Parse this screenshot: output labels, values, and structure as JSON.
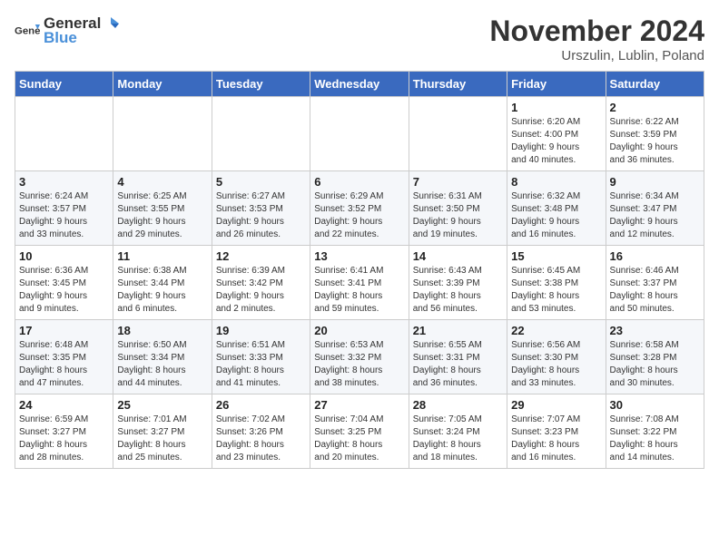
{
  "header": {
    "logo_general": "General",
    "logo_blue": "Blue",
    "month": "November 2024",
    "location": "Urszulin, Lublin, Poland"
  },
  "days_of_week": [
    "Sunday",
    "Monday",
    "Tuesday",
    "Wednesday",
    "Thursday",
    "Friday",
    "Saturday"
  ],
  "weeks": [
    [
      {
        "day": "",
        "info": ""
      },
      {
        "day": "",
        "info": ""
      },
      {
        "day": "",
        "info": ""
      },
      {
        "day": "",
        "info": ""
      },
      {
        "day": "",
        "info": ""
      },
      {
        "day": "1",
        "info": "Sunrise: 6:20 AM\nSunset: 4:00 PM\nDaylight: 9 hours\nand 40 minutes."
      },
      {
        "day": "2",
        "info": "Sunrise: 6:22 AM\nSunset: 3:59 PM\nDaylight: 9 hours\nand 36 minutes."
      }
    ],
    [
      {
        "day": "3",
        "info": "Sunrise: 6:24 AM\nSunset: 3:57 PM\nDaylight: 9 hours\nand 33 minutes."
      },
      {
        "day": "4",
        "info": "Sunrise: 6:25 AM\nSunset: 3:55 PM\nDaylight: 9 hours\nand 29 minutes."
      },
      {
        "day": "5",
        "info": "Sunrise: 6:27 AM\nSunset: 3:53 PM\nDaylight: 9 hours\nand 26 minutes."
      },
      {
        "day": "6",
        "info": "Sunrise: 6:29 AM\nSunset: 3:52 PM\nDaylight: 9 hours\nand 22 minutes."
      },
      {
        "day": "7",
        "info": "Sunrise: 6:31 AM\nSunset: 3:50 PM\nDaylight: 9 hours\nand 19 minutes."
      },
      {
        "day": "8",
        "info": "Sunrise: 6:32 AM\nSunset: 3:48 PM\nDaylight: 9 hours\nand 16 minutes."
      },
      {
        "day": "9",
        "info": "Sunrise: 6:34 AM\nSunset: 3:47 PM\nDaylight: 9 hours\nand 12 minutes."
      }
    ],
    [
      {
        "day": "10",
        "info": "Sunrise: 6:36 AM\nSunset: 3:45 PM\nDaylight: 9 hours\nand 9 minutes."
      },
      {
        "day": "11",
        "info": "Sunrise: 6:38 AM\nSunset: 3:44 PM\nDaylight: 9 hours\nand 6 minutes."
      },
      {
        "day": "12",
        "info": "Sunrise: 6:39 AM\nSunset: 3:42 PM\nDaylight: 9 hours\nand 2 minutes."
      },
      {
        "day": "13",
        "info": "Sunrise: 6:41 AM\nSunset: 3:41 PM\nDaylight: 8 hours\nand 59 minutes."
      },
      {
        "day": "14",
        "info": "Sunrise: 6:43 AM\nSunset: 3:39 PM\nDaylight: 8 hours\nand 56 minutes."
      },
      {
        "day": "15",
        "info": "Sunrise: 6:45 AM\nSunset: 3:38 PM\nDaylight: 8 hours\nand 53 minutes."
      },
      {
        "day": "16",
        "info": "Sunrise: 6:46 AM\nSunset: 3:37 PM\nDaylight: 8 hours\nand 50 minutes."
      }
    ],
    [
      {
        "day": "17",
        "info": "Sunrise: 6:48 AM\nSunset: 3:35 PM\nDaylight: 8 hours\nand 47 minutes."
      },
      {
        "day": "18",
        "info": "Sunrise: 6:50 AM\nSunset: 3:34 PM\nDaylight: 8 hours\nand 44 minutes."
      },
      {
        "day": "19",
        "info": "Sunrise: 6:51 AM\nSunset: 3:33 PM\nDaylight: 8 hours\nand 41 minutes."
      },
      {
        "day": "20",
        "info": "Sunrise: 6:53 AM\nSunset: 3:32 PM\nDaylight: 8 hours\nand 38 minutes."
      },
      {
        "day": "21",
        "info": "Sunrise: 6:55 AM\nSunset: 3:31 PM\nDaylight: 8 hours\nand 36 minutes."
      },
      {
        "day": "22",
        "info": "Sunrise: 6:56 AM\nSunset: 3:30 PM\nDaylight: 8 hours\nand 33 minutes."
      },
      {
        "day": "23",
        "info": "Sunrise: 6:58 AM\nSunset: 3:28 PM\nDaylight: 8 hours\nand 30 minutes."
      }
    ],
    [
      {
        "day": "24",
        "info": "Sunrise: 6:59 AM\nSunset: 3:27 PM\nDaylight: 8 hours\nand 28 minutes."
      },
      {
        "day": "25",
        "info": "Sunrise: 7:01 AM\nSunset: 3:27 PM\nDaylight: 8 hours\nand 25 minutes."
      },
      {
        "day": "26",
        "info": "Sunrise: 7:02 AM\nSunset: 3:26 PM\nDaylight: 8 hours\nand 23 minutes."
      },
      {
        "day": "27",
        "info": "Sunrise: 7:04 AM\nSunset: 3:25 PM\nDaylight: 8 hours\nand 20 minutes."
      },
      {
        "day": "28",
        "info": "Sunrise: 7:05 AM\nSunset: 3:24 PM\nDaylight: 8 hours\nand 18 minutes."
      },
      {
        "day": "29",
        "info": "Sunrise: 7:07 AM\nSunset: 3:23 PM\nDaylight: 8 hours\nand 16 minutes."
      },
      {
        "day": "30",
        "info": "Sunrise: 7:08 AM\nSunset: 3:22 PM\nDaylight: 8 hours\nand 14 minutes."
      }
    ]
  ]
}
